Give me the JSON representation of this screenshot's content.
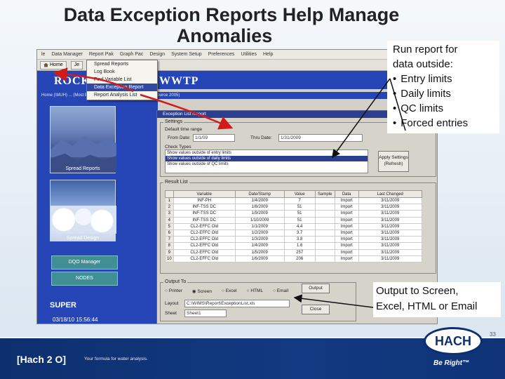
{
  "slide": {
    "title_line1": "Data Exception Reports Help Manage",
    "title_line2": "Anomalies",
    "page_number": "33"
  },
  "callouts": {
    "run_report": {
      "heading": "Run report for",
      "heading2": "data outside:",
      "items": [
        "Entry limits",
        "Daily limits",
        "QC limits",
        "Forced entries"
      ]
    },
    "output": {
      "line1": "Output to Screen,",
      "line2": "Excel, HTML or Email"
    }
  },
  "app": {
    "menu": [
      "le",
      "Data Manager",
      "Report Pak",
      "Graph Pac",
      "Design",
      "System Setup",
      "Preferences",
      "Utilities",
      "Help"
    ],
    "toolbar_home": "Home",
    "toolbar_je": "Je",
    "plant_name_left": "ROCK",
    "plant_name_right": "WWTP",
    "subbar_text": "Home (\\MUH) ... (Most Entered) [Test (FE)], Microsoft SVR - Source 2005)",
    "dropdown": [
      "Spread Reports",
      "Log Book",
      "Find Variable List",
      "Data Exception Report",
      "Report Analysis List"
    ],
    "side_caption1": "Spread Reports",
    "side_caption2": "Spread Design",
    "side_button1": "DQO Manager",
    "side_button2": "NODES",
    "user": "SUPER",
    "datetime": "03/18/10 15:56:44"
  },
  "dialog": {
    "title": "Exception List Report",
    "settings_label": "Settings",
    "default_range_label": "Default time range",
    "from_label": "From Date:",
    "from_value": "1/1/09",
    "to_label": "Thru Date:",
    "to_value": "1/31/2009",
    "check_label": "Check Types",
    "check_items": [
      "Show values outside of entry limits",
      "Show values outside of daily limits",
      "Show values outside of QC limits"
    ],
    "apply_button": "Apply Settings (Refresh)",
    "result_label": "Result List",
    "columns": [
      "",
      "Variable",
      "Date/Stamp",
      "Value",
      "Sample",
      "Data",
      "Last Changed"
    ],
    "rows": [
      [
        "1",
        "INF-PH",
        "1/4/2009",
        "7",
        "",
        "Import",
        "3/11/2009"
      ],
      [
        "2",
        "INF-TSS DC",
        "1/8/2009",
        "51",
        "",
        "Import",
        "3/11/2009"
      ],
      [
        "3",
        "INF-TSS DC",
        "1/9/2009",
        "51",
        "",
        "Import",
        "3/11/2009"
      ],
      [
        "4",
        "INF-TSS DC",
        "1/10/2009",
        "51",
        "",
        "Import",
        "3/11/2009"
      ],
      [
        "5",
        "CL2-EFFC Old",
        "1/1/2009",
        "4.4",
        "",
        "Import",
        "3/11/2009"
      ],
      [
        "6",
        "CL2-EFFC Old",
        "1/2/2009",
        "3.7",
        "",
        "Import",
        "3/11/2009"
      ],
      [
        "7",
        "CL2-EFFC Old",
        "1/3/2009",
        "3.8",
        "",
        "Import",
        "3/11/2009"
      ],
      [
        "8",
        "CL2-EFFC Old",
        "1/4/2009",
        "1.6",
        "",
        "Import",
        "3/11/2009"
      ],
      [
        "9",
        "CL2-EFFC Old",
        "1/5/2009",
        "257",
        "",
        "Import",
        "3/11/2009"
      ],
      [
        "10",
        "CL2-EFFC Old",
        "1/6/2009",
        "206",
        "",
        "Import",
        "3/11/2009"
      ]
    ],
    "output_label": "Output To",
    "output_options": [
      "Printer",
      "Screen",
      "Excel",
      "HTML",
      "Email"
    ],
    "output_button": "Output",
    "layout_label": "Layout",
    "layout_value": "C:\\WIMS\\Report\\ExceptionList.xls",
    "sheet_label": "Sheet",
    "sheet_value": "Sheet1",
    "close_button": "Close"
  },
  "footer": {
    "brand": "[Hach 2 O]",
    "tagline": "Your formula for water analysis.",
    "logo_text": "HACH",
    "slogan": "Be Right™"
  },
  "colors": {
    "app_blue": "#2646b7",
    "arrow_red": "#d21a1a",
    "footer_navy": "#0d2f6e"
  }
}
